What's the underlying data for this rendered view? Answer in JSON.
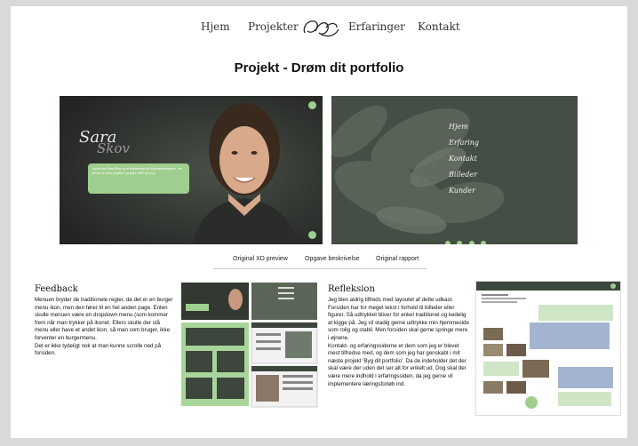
{
  "nav": {
    "items": [
      "Hjem",
      "Projekter",
      "Erfaringer",
      "Kontakt"
    ]
  },
  "page_title": "Projekt - Drøm dit portfolio",
  "preview_left": {
    "logo_line1": "Sara",
    "logo_line2": "Skov",
    "intro_text": "Jeg hedder Sara Skov og er studerende på Multimediedesigner. Her kan du se mine projekter og læse mere om mig."
  },
  "preview_right": {
    "menu": [
      "Hjem",
      "Erfaring",
      "Kontakt",
      "Billeder",
      "Kunder"
    ]
  },
  "project_links": [
    "Original XD preview",
    "Opgave beskrivelse",
    "Original rapport"
  ],
  "feedback": {
    "heading": "Feedback",
    "paragraph1": "Menuen bryder de traditionele regler, da det er en burger menu ikon, men den fører til en hel anden page. Enten skulle menuen være en dropdown menu (som kommer frem når man trykker på ikonet. Ellers skulle der stå menu eller have et andet ikon, så man som bruger, ikke forventer en burgermenu.",
    "paragraph2": "Det er ikke tydeligt nok at man kunne scrolle ned på forsiden."
  },
  "reflection": {
    "heading": "Refleksion",
    "paragraph1": "Jeg blev aldrig tilfreds med layoutet af dette udkast. Forsiden har for meget tekst i forhold til billeder eller figurer. Så udtrykket bliver for enkel traditionel og kedelig at kigge på. Jeg vil stadig gerne udtrykke min hjemmeside som rolig og stabil. Men forsiden skal gerne springe mere i øjnene.",
    "paragraph2": "Kontakt- og erfaringssiderne er dem som jeg er blevet mest tilfredse med, og dem som jeg har genskabt i mit næste projekt 'Byg dit portfolio'. Da de indeholder det der skal være der uden det ser alt for enkelt ud. Dog skal der være mere indhold i erfaringssiden, da jeg gerne vil implementere læringsforløb ind."
  },
  "colors": {
    "background": "#d9d9d9",
    "page": "#ffffff",
    "accent_green": "#9fcf8e",
    "dark_green": "#3c463b"
  }
}
